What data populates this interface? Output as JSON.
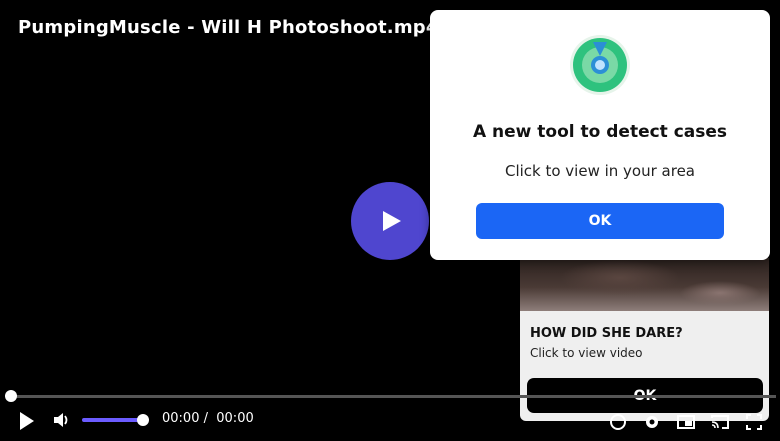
{
  "video": {
    "title": "PumpingMuscle - Will H Photoshoot.mp4",
    "current_time": "00:00",
    "separator": "/",
    "duration": "00:00",
    "progress": 0,
    "volume": 1.0
  },
  "popup": {
    "title": "A new tool to detect cases",
    "text": "Click to view in your area",
    "ok_label": "OK"
  },
  "ad": {
    "title": "HOW DID SHE DARE?",
    "subtitle": "Click to view video",
    "ok_label": "OK"
  },
  "colors": {
    "play_button": "#4f46cf",
    "popup_ok": "#1b66f5",
    "volume_bar": "#6b5cff"
  }
}
